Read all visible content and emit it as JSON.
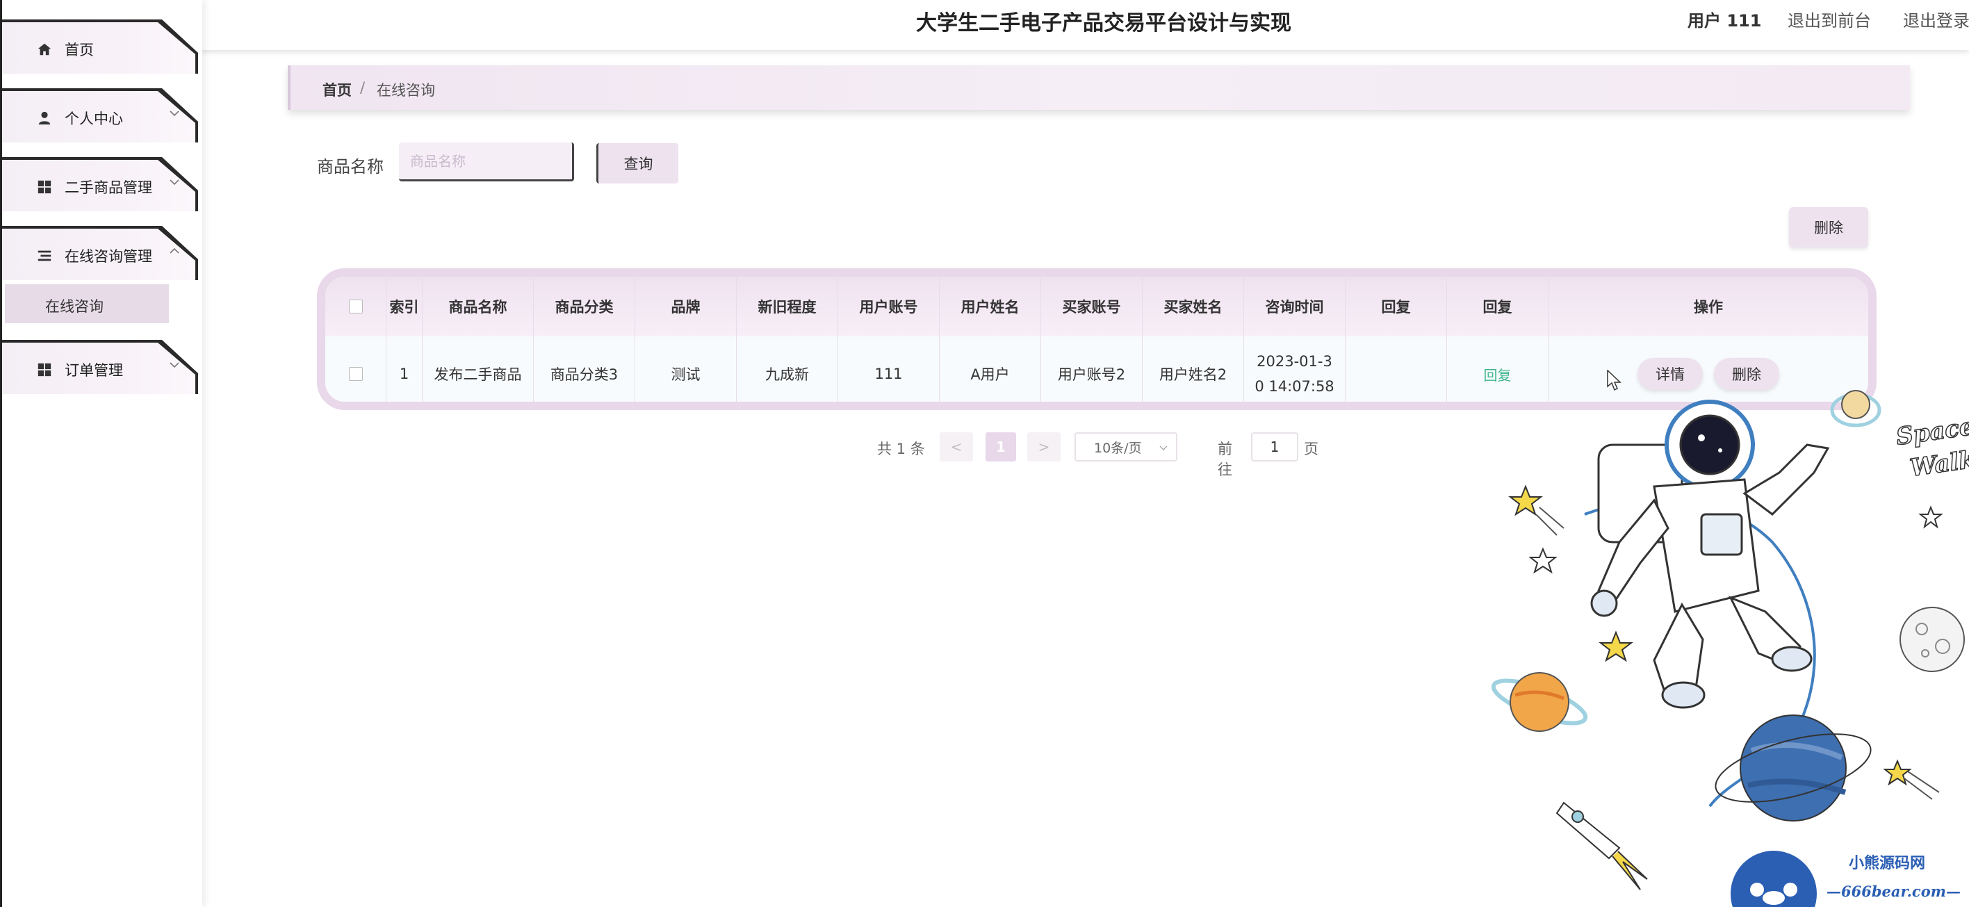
{
  "header": {
    "title": "大学生二手电子产品交易平台设计与实现",
    "user": "用户 111",
    "back_to_front": "退出到前台",
    "logout": "退出登录"
  },
  "sidebar": {
    "items": [
      {
        "label": "首页",
        "icon": "home-icon"
      },
      {
        "label": "个人中心",
        "icon": "user-icon",
        "expandable": true
      },
      {
        "label": "二手商品管理",
        "icon": "grid-icon",
        "expandable": true
      },
      {
        "label": "在线咨询管理",
        "icon": "list-icon",
        "expandable": true,
        "expanded": true
      },
      {
        "label": "订单管理",
        "icon": "grid-icon",
        "expandable": true
      }
    ],
    "submenu": {
      "label": "在线咨询"
    }
  },
  "breadcrumb": {
    "home": "首页",
    "separator": "/",
    "current": "在线咨询"
  },
  "search": {
    "label": "商品名称",
    "placeholder": "商品名称",
    "value": "",
    "button": "查询"
  },
  "toolbar": {
    "delete_label": "删除"
  },
  "table": {
    "headers": [
      "",
      "索引",
      "商品名称",
      "商品分类",
      "品牌",
      "新旧程度",
      "用户账号",
      "用户姓名",
      "买家账号",
      "买家姓名",
      "咨询时间",
      "回复",
      "回复",
      "操作"
    ],
    "rows": [
      {
        "index": "1",
        "product_name": "发布二手商品",
        "category": "商品分类3",
        "brand": "测试",
        "condition": "九成新",
        "user_account": "111",
        "user_name": "A用户",
        "buyer_account": "用户账号2",
        "buyer_name": "用户姓名2",
        "consult_time": "2023-01-3\n0 14:07:58",
        "reply": "",
        "reply_action": "回复",
        "detail_button": "详情",
        "delete_button": "删除"
      }
    ]
  },
  "pagination": {
    "total_text": "共 1 条",
    "prev": "<",
    "current_page": "1",
    "next": ">",
    "page_size": "10条/页",
    "goto_label": "前往",
    "goto_value": "1",
    "goto_suffix": "页"
  },
  "illustration": {
    "text": "Space Walk"
  },
  "watermark": {
    "cn": "小熊源码网",
    "en": "—666bear.com—"
  },
  "colors": {
    "accent": "#e8d8ea",
    "sidebar_bg": "#f6f0f7",
    "reply_link": "#3eb58c",
    "watermark": "#2b5fb4"
  }
}
